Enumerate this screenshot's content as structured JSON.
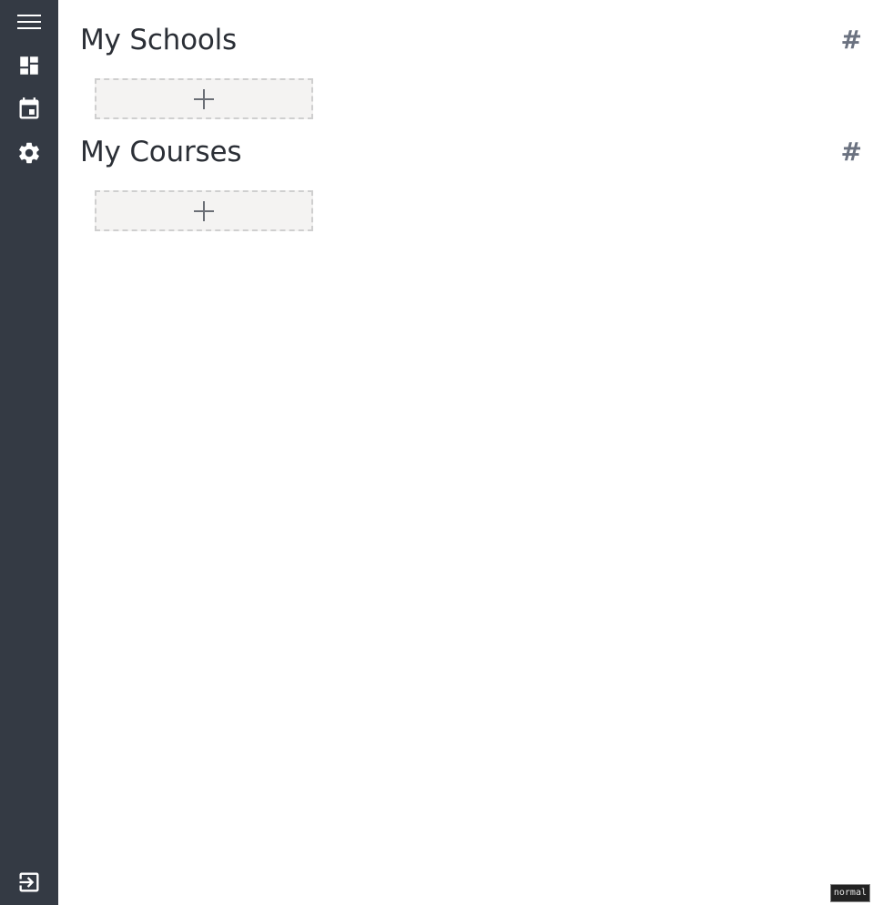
{
  "sidebar": {
    "items": [
      {
        "name": "menu",
        "icon": "menu-icon"
      },
      {
        "name": "dashboard",
        "icon": "dashboard-icon"
      },
      {
        "name": "calendar",
        "icon": "calendar-icon"
      },
      {
        "name": "settings",
        "icon": "gear-icon"
      }
    ],
    "logout_icon": "logout-icon"
  },
  "sections": [
    {
      "title": "My Schools",
      "anchor": "#",
      "add_icon": "plus-icon"
    },
    {
      "title": "My Courses",
      "anchor": "#",
      "add_icon": "plus-icon"
    }
  ],
  "status_badge": "normal",
  "colors": {
    "sidebar_bg": "#343a44",
    "icon": "#ffffff",
    "title": "#2b2f36",
    "anchor": "#6b7280",
    "card_bg": "#f4f3f2",
    "card_border": "#cfcfcf"
  }
}
